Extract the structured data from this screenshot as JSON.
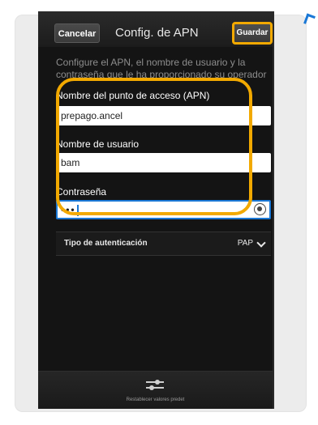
{
  "header": {
    "cancel_label": "Cancelar",
    "title": "Config. de APN",
    "save_label": "Guardar"
  },
  "description": "Configure el APN, el nombre de usuario y la contraseña que le ha proporcionado su operador",
  "fields": {
    "apn_label": "Nombre del punto de acceso (APN)",
    "apn_value": "prepago.ancel",
    "user_label": "Nombre de usuario",
    "user_value": "bam",
    "password_label": "Contraseña",
    "password_value": "•••"
  },
  "auth": {
    "label": "Tipo de autenticación",
    "value": "PAP"
  },
  "bottom": {
    "label": "Restablecer valores predet"
  },
  "colors": {
    "highlight": "#f2a900",
    "focus": "#1a78d6"
  }
}
